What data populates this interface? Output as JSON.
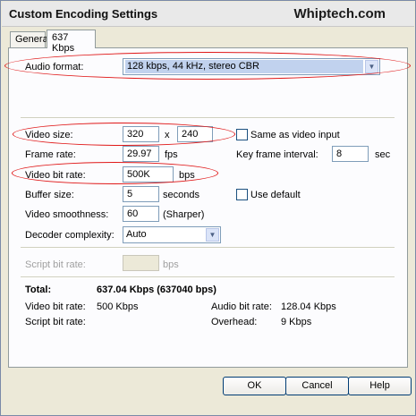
{
  "window": {
    "title": "Custom Encoding Settings",
    "watermark": "Whiptech.com"
  },
  "tabs": [
    {
      "label": "General"
    },
    {
      "label": "637 Kbps"
    }
  ],
  "audio": {
    "label": "Audio format:",
    "value": "128 kbps, 44 kHz, stereo CBR"
  },
  "video": {
    "size_label": "Video size:",
    "width": "320",
    "x_label": "x",
    "height": "240",
    "same_as_input_label": "Same as video input",
    "frame_rate_label": "Frame rate:",
    "frame_rate": "29.97",
    "fps_label": "fps",
    "key_frame_label": "Key frame interval:",
    "key_frame": "8",
    "sec_label": "sec",
    "bit_rate_label": "Video bit rate:",
    "bit_rate": "500K",
    "bps_label": "bps",
    "buffer_label": "Buffer size:",
    "buffer": "5",
    "seconds_label": "seconds",
    "use_default_label": "Use default",
    "smoothness_label": "Video smoothness:",
    "smoothness": "60",
    "sharper_label": "(Sharper)",
    "decoder_label": "Decoder complexity:",
    "decoder": "Auto"
  },
  "script": {
    "label": "Script bit rate:",
    "value": "",
    "unit": "bps"
  },
  "totals": {
    "total_label": "Total:",
    "total_value": "637.04 Kbps (637040 bps)",
    "video_label": "Video bit rate:",
    "video_value": "500 Kbps",
    "audio_label": "Audio bit rate:",
    "audio_value": "128.04 Kbps",
    "script_label": "Script bit rate:",
    "overhead_label": "Overhead:",
    "overhead_value": "9 Kbps"
  },
  "buttons": {
    "ok": "OK",
    "cancel": "Cancel",
    "help": "Help"
  }
}
